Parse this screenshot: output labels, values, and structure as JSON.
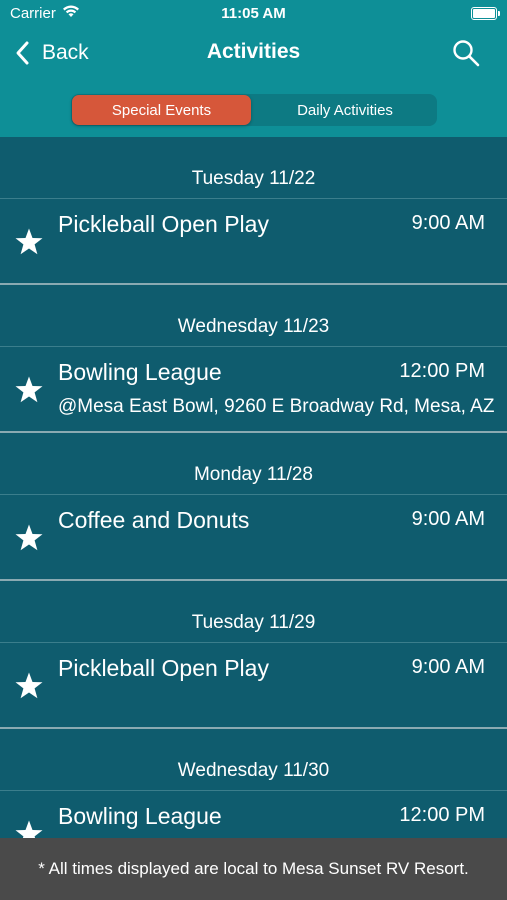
{
  "status": {
    "carrier": "Carrier",
    "time": "11:05 AM"
  },
  "nav": {
    "back_label": "Back",
    "title": "Activities"
  },
  "tabs": [
    {
      "label": "Special Events",
      "selected": true
    },
    {
      "label": "Daily Activities",
      "selected": false
    }
  ],
  "days": [
    {
      "date": "Tuesday 11/22",
      "events": [
        {
          "title": "Pickleball Open Play",
          "time": "9:00 AM",
          "location": ""
        }
      ]
    },
    {
      "date": "Wednesday 11/23",
      "events": [
        {
          "title": "Bowling League",
          "time": "12:00 PM",
          "location": "@Mesa East Bowl, 9260 E Broadway Rd, Mesa, AZ"
        }
      ]
    },
    {
      "date": "Monday 11/28",
      "events": [
        {
          "title": "Coffee and Donuts",
          "time": "9:00 AM",
          "location": ""
        }
      ]
    },
    {
      "date": "Tuesday 11/29",
      "events": [
        {
          "title": "Pickleball Open Play",
          "time": "9:00 AM",
          "location": ""
        }
      ]
    },
    {
      "date": "Wednesday 11/30",
      "events": [
        {
          "title": "Bowling League",
          "time": "12:00 PM",
          "location": ""
        }
      ]
    }
  ],
  "footer": {
    "note": "* All times displayed are local to Mesa Sunset RV Resort."
  },
  "colors": {
    "header": "#0e8f97",
    "list_bg": "#0f5c6e",
    "accent": "#d6573a",
    "footer": "#4a4a4a"
  },
  "icons": {
    "back": "chevron-left-icon",
    "search": "search-icon",
    "favorite": "star-icon",
    "wifi": "wifi-icon",
    "battery": "battery-icon"
  }
}
